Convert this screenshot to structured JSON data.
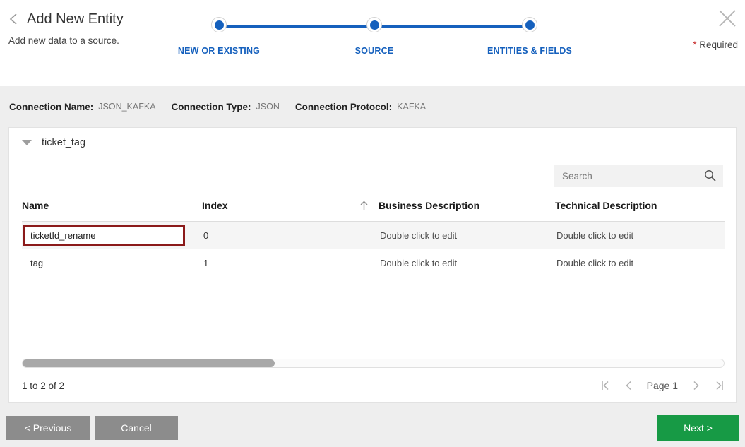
{
  "header": {
    "title": "Add New Entity",
    "subtitle": "Add new data to a source.",
    "back_icon": "back-chevron-icon",
    "close_icon": "close-icon",
    "required_star": "*",
    "required_text": " Required",
    "accent_blue": "#1560bd"
  },
  "stepper": {
    "steps": [
      {
        "label": "NEW OR EXISTING"
      },
      {
        "label": "SOURCE"
      },
      {
        "label": "ENTITIES & FIELDS"
      }
    ]
  },
  "connection": {
    "name_label": "Connection Name:",
    "name_value": "JSON_KAFKA",
    "type_label": "Connection Type:",
    "type_value": "JSON",
    "protocol_label": "Connection Protocol:",
    "protocol_value": "KAFKA"
  },
  "panel": {
    "title": "ticket_tag",
    "caret_icon": "chevron-down-icon"
  },
  "search": {
    "placeholder": "Search",
    "value": "",
    "icon": "search-icon"
  },
  "table": {
    "columns": [
      {
        "label": "Name"
      },
      {
        "label": "Index",
        "sort_icon": "sort-ascending-arrow-icon"
      },
      {
        "label": "Business Description"
      },
      {
        "label": "Technical Description"
      }
    ],
    "rows": [
      {
        "name": "ticketId_rename",
        "name_editing": true,
        "index": "0",
        "business_description": "Double click to edit",
        "technical_description": "Double click to edit"
      },
      {
        "name": "tag",
        "name_editing": false,
        "index": "1",
        "business_description": "Double click to edit",
        "technical_description": "Double click to edit"
      }
    ],
    "edit_border_color": "#8b1a1a"
  },
  "pagination": {
    "count_text": "1 to 2 of 2",
    "page_label": "Page 1",
    "first_icon": "first-page-icon",
    "prev_icon": "previous-page-icon",
    "next_icon": "next-page-icon",
    "last_icon": "last-page-icon"
  },
  "footer": {
    "previous_label": "< Previous",
    "cancel_label": "Cancel",
    "next_label": "Next >",
    "next_color": "#179a45"
  }
}
